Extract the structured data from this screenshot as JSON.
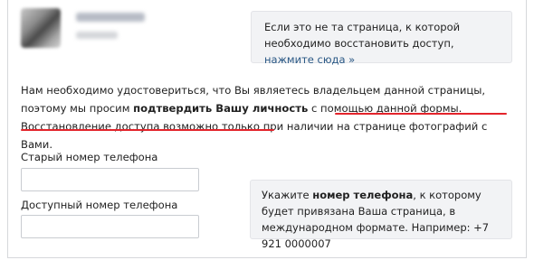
{
  "profile": {
    "avatar_icon": "blurred-avatar",
    "name": "",
    "subtitle": ""
  },
  "info_box": {
    "text": "Если это не та страница, к которой необходимо восстановить доступ,",
    "link": "нажмите сюда »"
  },
  "main": {
    "part1": "Нам необходимо удостовериться, что Вы являетесь владельцем данной страницы, поэтому мы просим ",
    "bold": "подтвердить Вашу личность",
    "part2": " с помощью данной формы. ",
    "highlight1": "Восстановление доступа возможно",
    "highlight2": "только при наличии на странице фотографий с Вами",
    "end": "."
  },
  "form": {
    "old_phone_label": "Старый номер телефона",
    "old_phone_value": "",
    "available_phone_label": "Доступный номер телефона",
    "available_phone_value": ""
  },
  "hint": {
    "prefix": "Укажите ",
    "bold": "номер телефона",
    "suffix": ", к которому будет привязана Ваша страница, в международном формате. Например: +7 921 0000007"
  },
  "colors": {
    "link": "#2a5885",
    "underline": "#e3242b",
    "box_bg": "#f2f3f5"
  }
}
